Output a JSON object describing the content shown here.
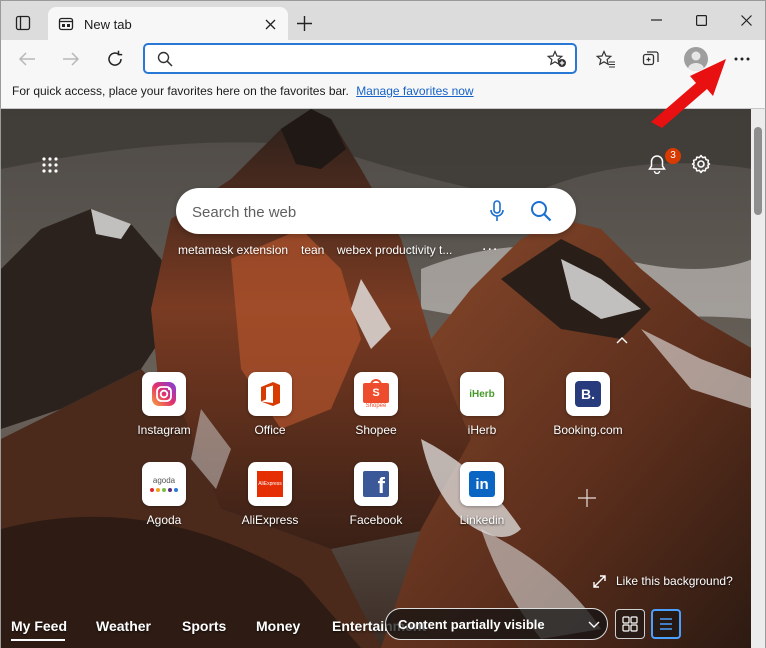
{
  "tab": {
    "title": "New tab"
  },
  "address": {
    "value": "",
    "placeholder": ""
  },
  "favorites_bar": {
    "message": "For quick access, place your favorites here on the favorites bar.",
    "link": "Manage favorites now"
  },
  "ntp": {
    "notification_count": "3",
    "search_placeholder": "Search the web",
    "trending": [
      "metamask extension",
      "tean",
      "webex productivity t..."
    ],
    "trending_more": "...",
    "tiles": [
      {
        "label": "Instagram",
        "icon": "instagram-icon"
      },
      {
        "label": "Office",
        "icon": "office-icon"
      },
      {
        "label": "Shopee",
        "icon": "shopee-icon",
        "icon_text": "Shopee"
      },
      {
        "label": "iHerb",
        "icon": "iherb-icon",
        "icon_text": "iHerb"
      },
      {
        "label": "Booking.com",
        "icon": "booking-icon",
        "icon_text": "B."
      },
      {
        "label": "Agoda",
        "icon": "agoda-icon",
        "icon_text": "agoda"
      },
      {
        "label": "AliExpress",
        "icon": "aliexpress-icon",
        "icon_text": "AliExpress"
      },
      {
        "label": "Facebook",
        "icon": "facebook-icon",
        "icon_text": "f"
      },
      {
        "label": "Linkedin",
        "icon": "linkedin-icon",
        "icon_text": "in"
      }
    ],
    "like_background": "Like this background?",
    "feed_tabs": [
      "My Feed",
      "Weather",
      "Sports",
      "Money",
      "Entertainment"
    ],
    "layout_option": "Content partially visible"
  },
  "colors": {
    "accent": "#2a78d6",
    "link": "#1762c7",
    "badge": "#d83b01",
    "arrow": "#e81010"
  }
}
